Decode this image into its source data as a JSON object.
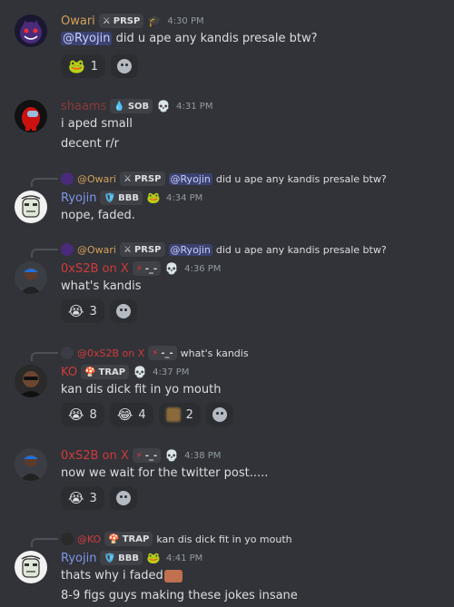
{
  "colors": {
    "background": "#313338",
    "owari": "#d4a05a",
    "shaams": "#8b3a3a",
    "ryojin": "#7f95e8",
    "xs2b": "#d13b3b",
    "ko": "#d13b3b",
    "mention_bg": "#3c4270"
  },
  "messages": [
    {
      "username": "Owari",
      "tag": "PRSP",
      "tag_icon": "sword-icon",
      "badge_icon": "hat-icon",
      "time": "4:30 PM",
      "lines": [
        "did u ape any kandis presale btw?"
      ],
      "mention": "@Ryojin",
      "reactions": [
        {
          "emoji": "pepe-icon",
          "count": "1"
        }
      ]
    },
    {
      "username": "shaams",
      "tag": "SOB",
      "tag_icon": "droplet-icon",
      "badge_icon": "skull-icon",
      "time": "4:31 PM",
      "lines": [
        "i aped small",
        "decent r/r"
      ]
    },
    {
      "reply": {
        "username": "@Owari",
        "tag": "PRSP",
        "mention": "@Ryojin",
        "text": "did u ape any kandis presale btw?"
      },
      "username": "Ryojin",
      "tag": "BBB",
      "tag_icon": "shield-icon",
      "badge_icon": "pepe-icon",
      "time": "4:34 PM",
      "lines": [
        "nope, faded."
      ]
    },
    {
      "reply": {
        "username": "@Owari",
        "tag": "PRSP",
        "mention": "@Ryojin",
        "text": "did u ape any kandis presale btw?"
      },
      "username": "0xS2B on X",
      "tag": "-_-",
      "tag_icon": "lightning-icon",
      "badge_icon": "skull-icon",
      "time": "4:36 PM",
      "lines": [
        "what's kandis"
      ],
      "reactions": [
        {
          "emoji": "crying-face-icon",
          "count": "3"
        }
      ]
    },
    {
      "reply": {
        "username": "@0xS2B on X",
        "tag": "-_-",
        "text": "what's kandis"
      },
      "username": "KO",
      "tag": "TRAP",
      "tag_icon": "mushroom-icon",
      "badge_icon": "skull-icon",
      "time": "4:37 PM",
      "lines": [
        "kan dis dick fit in yo mouth"
      ],
      "reactions": [
        {
          "emoji": "crying-face-icon",
          "count": "8"
        },
        {
          "emoji": "laugh-cry-icon",
          "count": "4"
        },
        {
          "emoji": "blurred-emoji-icon",
          "count": "2"
        }
      ]
    },
    {
      "username": "0xS2B on X",
      "tag": "-_-",
      "tag_icon": "lightning-icon",
      "badge_icon": "skull-icon",
      "time": "4:38 PM",
      "lines": [
        "now we wait for the twitter post....."
      ],
      "reactions": [
        {
          "emoji": "crying-face-icon",
          "count": "3"
        }
      ]
    },
    {
      "reply": {
        "username": "@KO",
        "tag": "TRAP",
        "text": "kan dis dick fit in yo mouth"
      },
      "username": "Ryojin",
      "tag": "BBB",
      "tag_icon": "shield-icon",
      "badge_icon": "pepe-icon",
      "time": "4:41 PM",
      "lines": [
        "thats why i faded",
        "8-9 figs guys making these jokes insane"
      ]
    }
  ]
}
